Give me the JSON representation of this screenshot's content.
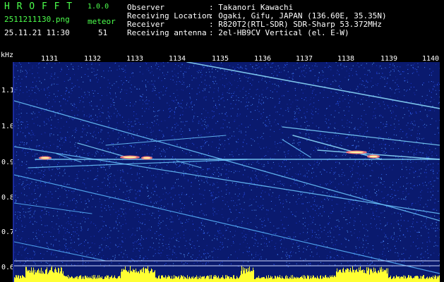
{
  "app": {
    "name": "H R O F F T",
    "version": "1.0.0",
    "filename": "2511211130.png",
    "timestamp": "25.11.21 11:30",
    "meteor_label": "meteor",
    "meteor_count": "51"
  },
  "info": {
    "rows": [
      {
        "key": "Observer",
        "value": ": Takanori Kawachi"
      },
      {
        "key": "Receiving Location",
        "value": ": Ogaki, Gifu, JAPAN (136.60E, 35.35N)"
      },
      {
        "key": "Receiver",
        "value": ": R820T2(RTL-SDR) SDR-Sharp 53.372MHz"
      },
      {
        "key": "Receiving antenna",
        "value": ": 2el-HB9CV Vertical (el. E-W)"
      }
    ]
  },
  "time_axis": {
    "labels": [
      "1131",
      "1132",
      "1133",
      "1134",
      "1135",
      "1136",
      "1137",
      "1138",
      "1139",
      "1140"
    ]
  },
  "freq_axis": {
    "unit": "kHz",
    "labels": [
      "1.1",
      "1.0",
      "0.9",
      "0.8",
      "0.7",
      "0.6"
    ]
  },
  "colors": {
    "background": "#0a1a6e",
    "header_green": "#4cff4c",
    "text_white": "#ffffff",
    "level_yellow": "#ffff33",
    "trace_cyan": "#7fd8ff"
  }
}
